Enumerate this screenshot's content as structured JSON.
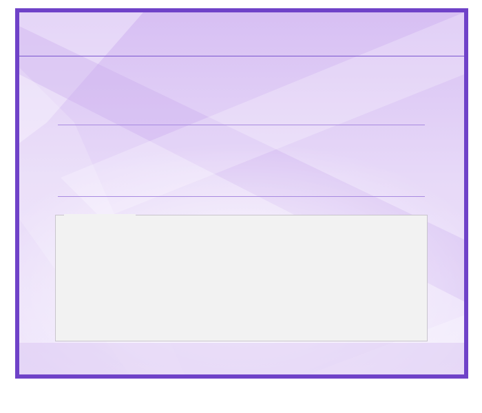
{
  "window": {
    "title": "",
    "accent_color": "#6f42c8",
    "background_color": "#e4d3f6",
    "divider_color": "#a88ae0",
    "group_background": "#f2f2f2",
    "group_border_color": "#c8c4cc"
  },
  "sections": [
    {
      "label": ""
    },
    {
      "label": ""
    }
  ],
  "group": {
    "legend": "",
    "content": ""
  }
}
